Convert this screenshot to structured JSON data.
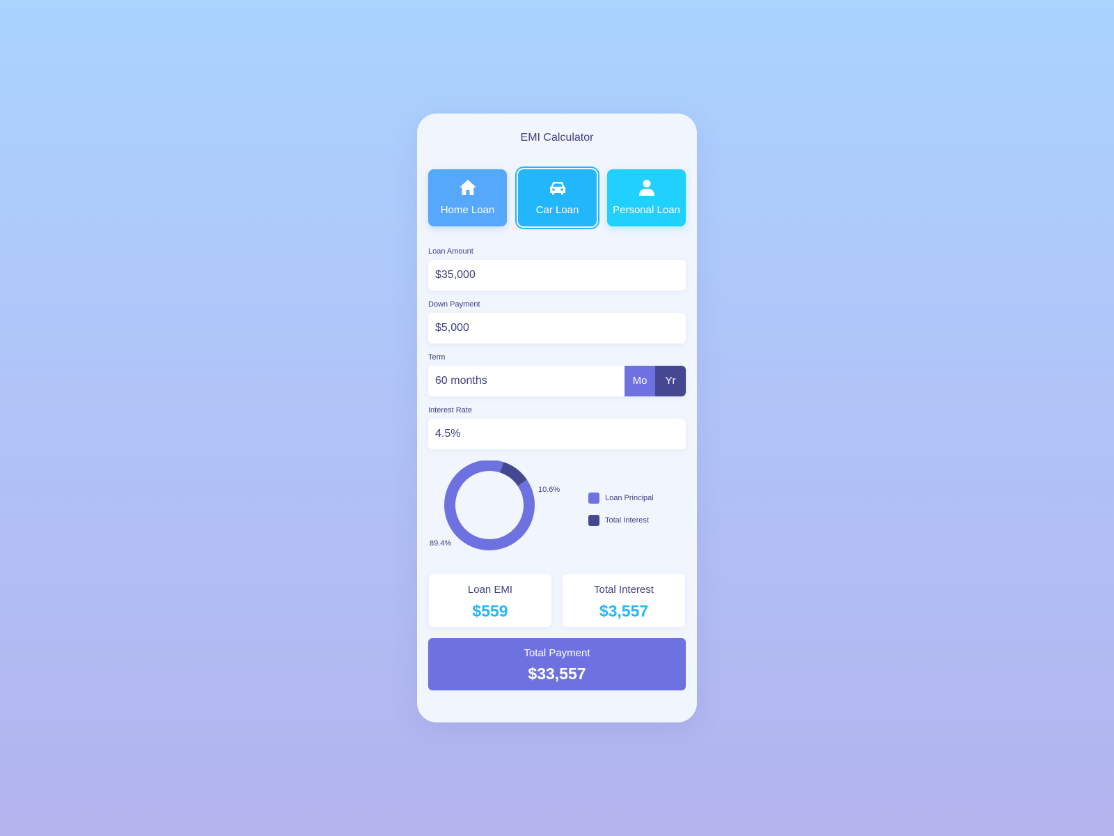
{
  "app": {
    "title": "EMI Calculator"
  },
  "tabs": [
    {
      "label": "Home Loan",
      "icon": "home-icon",
      "color": "#56a8fb"
    },
    {
      "label": "Car Loan",
      "icon": "car-icon",
      "color": "#22b7fb",
      "selected": true
    },
    {
      "label": "Personal Loan",
      "icon": "person-icon",
      "color": "#1fd1fc"
    }
  ],
  "form": {
    "loan_amount": {
      "label": "Loan Amount",
      "value": "$35,000"
    },
    "down_payment": {
      "label": "Down Payment",
      "value": "$5,000"
    },
    "term": {
      "label": "Term",
      "value": "60 months",
      "unit_options": [
        "Mo",
        "Yr"
      ]
    },
    "interest_rate": {
      "label": "Interest Rate",
      "value": "4.5%"
    }
  },
  "chart_data": {
    "type": "pie",
    "style": "donut",
    "categories": [
      "Loan Principal",
      "Total Interest"
    ],
    "values": [
      89.4,
      10.6
    ],
    "value_labels": [
      "89.4%",
      "10.6%"
    ],
    "colors": [
      "#6e72e0",
      "#454891"
    ],
    "legend_position": "right"
  },
  "summary": {
    "loan_emi": {
      "label": "Loan EMI",
      "value": "$559"
    },
    "total_interest": {
      "label": "Total Interest",
      "value": "$3,557"
    },
    "total_payment": {
      "label": "Total Payment",
      "value": "$33,557"
    }
  },
  "colors": {
    "accent": "#22b7fb",
    "primary": "#6e72e0",
    "dark": "#454891",
    "text": "#3f4280"
  }
}
